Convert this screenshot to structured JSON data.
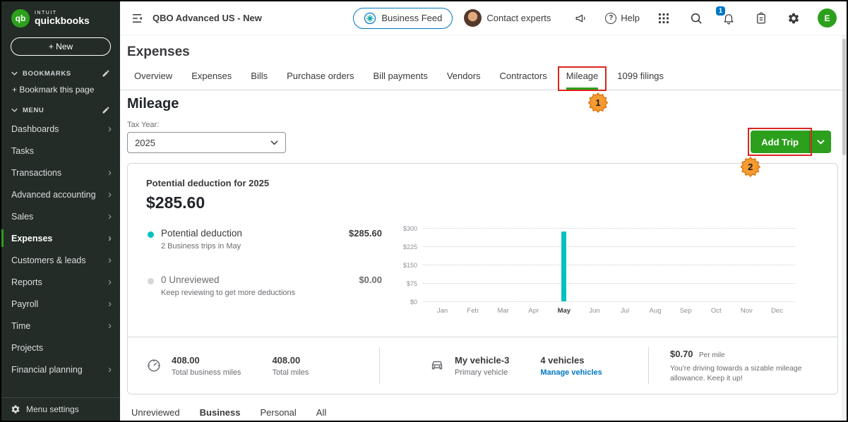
{
  "colors": {
    "qb_green": "#2ca01c",
    "chart_teal": "#00c1bf",
    "link_blue": "#0077c5",
    "annotation_red": "#d9261c",
    "annotation_orange": "#f59b31"
  },
  "sidebar": {
    "brand_intuit": "INTUIT",
    "brand_name": "quickbooks",
    "new_button": "+ New",
    "bookmarks_label": "BOOKMARKS",
    "bookmark_this_page": "+ Bookmark this page",
    "menu_label": "MENU",
    "items": [
      {
        "label": "Dashboards",
        "chevron": true
      },
      {
        "label": "Tasks",
        "chevron": false
      },
      {
        "label": "Transactions",
        "chevron": true
      },
      {
        "label": "Advanced accounting",
        "chevron": true
      },
      {
        "label": "Sales",
        "chevron": true
      },
      {
        "label": "Expenses",
        "chevron": true,
        "active": true
      },
      {
        "label": "Customers & leads",
        "chevron": true
      },
      {
        "label": "Reports",
        "chevron": true
      },
      {
        "label": "Payroll",
        "chevron": true
      },
      {
        "label": "Time",
        "chevron": true
      },
      {
        "label": "Projects",
        "chevron": false
      },
      {
        "label": "Financial planning",
        "chevron": true
      }
    ],
    "menu_settings": "Menu settings"
  },
  "header": {
    "company_name": "QBO Advanced US - New",
    "business_feed_label": "Business Feed",
    "contact_experts_label": "Contact experts",
    "help_label": "Help",
    "notification_badge": "1",
    "avatar_initial": "E"
  },
  "page": {
    "title": "Expenses",
    "tabs": [
      {
        "label": "Overview"
      },
      {
        "label": "Expenses"
      },
      {
        "label": "Bills"
      },
      {
        "label": "Purchase orders"
      },
      {
        "label": "Bill payments"
      },
      {
        "label": "Vendors"
      },
      {
        "label": "Contractors"
      },
      {
        "label": "Mileage",
        "active": true
      },
      {
        "label": "1099 filings"
      }
    ]
  },
  "mileage": {
    "heading": "Mileage",
    "tax_year_label": "Tax Year:",
    "tax_year_value": "2025",
    "add_trip_label": "Add Trip",
    "summary": {
      "title": "Potential deduction for 2025",
      "amount": "$285.60",
      "legend": [
        {
          "label": "Potential deduction",
          "description": "2 Business trips in May",
          "amount": "$285.60"
        },
        {
          "label": "0 Unreviewed",
          "description": "Keep reviewing to get more deductions",
          "amount": "$0.00"
        }
      ]
    },
    "stats": {
      "business_miles_value": "408.00",
      "business_miles_label": "Total business miles",
      "total_miles_value": "408.00",
      "total_miles_label": "Total miles",
      "vehicle_name": "My vehicle-3",
      "vehicle_type": "Primary vehicle",
      "vehicle_count": "4 vehicles",
      "manage_vehicles_link": "Manage vehicles",
      "rate_value": "$0.70",
      "rate_unit": "Per mile",
      "rate_message": "You're driving towards a sizable mileage allowance. Keep it up!"
    },
    "filter_tabs": [
      "Unreviewed",
      "Business",
      "Personal",
      "All"
    ]
  },
  "chart_data": {
    "type": "bar",
    "title": "Potential deduction for 2025",
    "categories": [
      "Jan",
      "Feb",
      "Mar",
      "Apr",
      "May",
      "Jun",
      "Jul",
      "Aug",
      "Sep",
      "Oct",
      "Nov",
      "Dec"
    ],
    "values": [
      0,
      0,
      0,
      0,
      285.6,
      0,
      0,
      0,
      0,
      0,
      0,
      0
    ],
    "ylabel_ticks": [
      "$0",
      "$75",
      "$150",
      "$225",
      "$300"
    ],
    "ylim": [
      0,
      300
    ],
    "bar_color": "#00c1bf",
    "grid": "dotted-horizontal",
    "legend_position": "left"
  },
  "annotations": [
    {
      "number": "1",
      "target": "Mileage tab"
    },
    {
      "number": "2",
      "target": "Add Trip button"
    }
  ]
}
